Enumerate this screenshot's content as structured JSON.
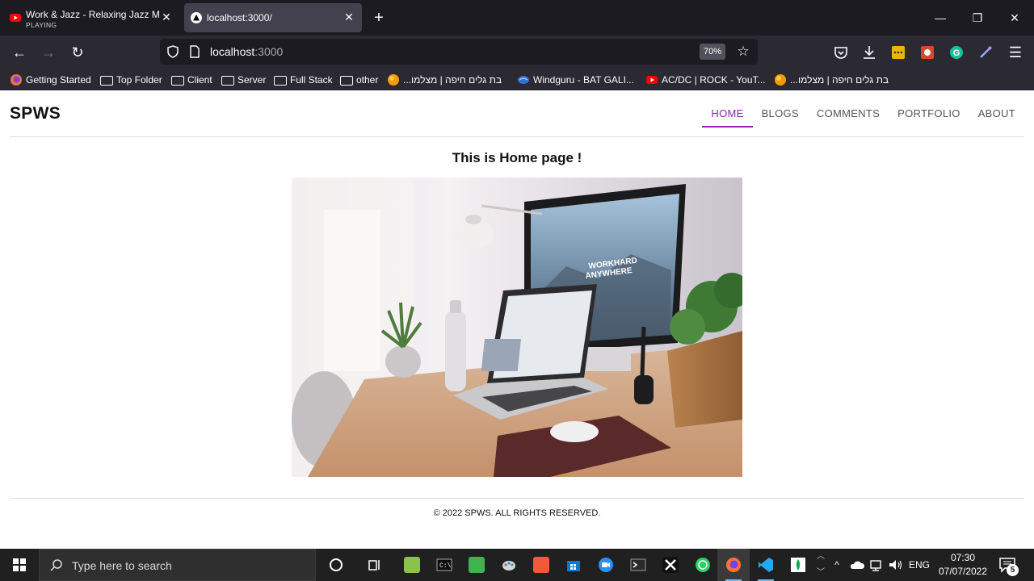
{
  "browser": {
    "tabs": [
      {
        "title": "Work & Jazz - Relaxing Jazz Music",
        "subtitle": "PLAYING",
        "icon": "youtube-icon"
      },
      {
        "title": "localhost:3000/",
        "subtitle": "",
        "icon": "nextjs-icon"
      }
    ],
    "url_host": "localhost",
    "url_port": ":3000",
    "zoom": "70%",
    "bookmarks": [
      {
        "label": "Getting Started",
        "icon": "firefox-icon"
      },
      {
        "label": "Top Folder",
        "icon": "folder-icon"
      },
      {
        "label": "Client",
        "icon": "folder-icon"
      },
      {
        "label": "Server",
        "icon": "folder-icon"
      },
      {
        "label": "Full Stack",
        "icon": "folder-icon"
      },
      {
        "label": "other",
        "icon": "folder-icon"
      },
      {
        "label": "בת גלים חיפה | מצלמו...",
        "icon": "orange-globe-icon"
      },
      {
        "label": "Windguru - BAT GALI...",
        "icon": "windguru-icon"
      },
      {
        "label": "AC/DC | ROCK - YouT...",
        "icon": "youtube-icon"
      },
      {
        "label": "בת גלים חיפה | מצלמו...",
        "icon": "orange-globe-icon"
      }
    ]
  },
  "site": {
    "brand": "SPWS",
    "nav": [
      "HOME",
      "BLOGS",
      "COMMENTS",
      "PORTFOLIO",
      "ABOUT"
    ],
    "active_nav": "HOME",
    "home_title": "This is Home page !",
    "hero_image_text": [
      "WORKHARD",
      "ANYWHERE"
    ],
    "footer": "© 2022 SPWS. ALL RIGHTS RESERVED."
  },
  "taskbar": {
    "search_placeholder": "Type here to search",
    "language": "ENG",
    "time": "07:30",
    "date": "07/07/2022",
    "notification_count": "5"
  },
  "colors": {
    "accent": "#8e24aa",
    "browser_dark": "#1c1b22",
    "toolbar": "#2b2a33",
    "taskbar": "#202020"
  }
}
